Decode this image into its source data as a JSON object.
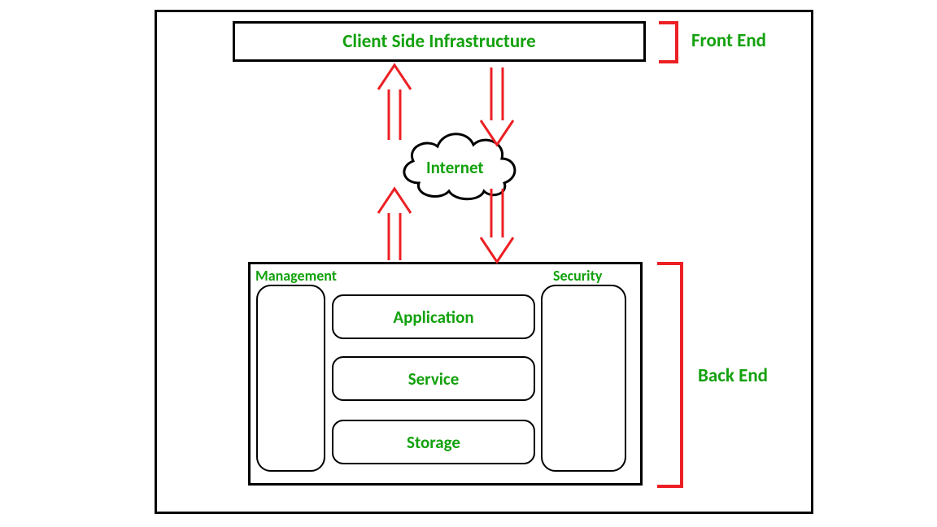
{
  "client_box": "Client Side Infrastructure",
  "front_end": "Front End",
  "back_end": "Back End",
  "internet": "Internet",
  "management": "Management",
  "security": "Security",
  "application": "Application",
  "service": "Service",
  "storage": "Storage"
}
